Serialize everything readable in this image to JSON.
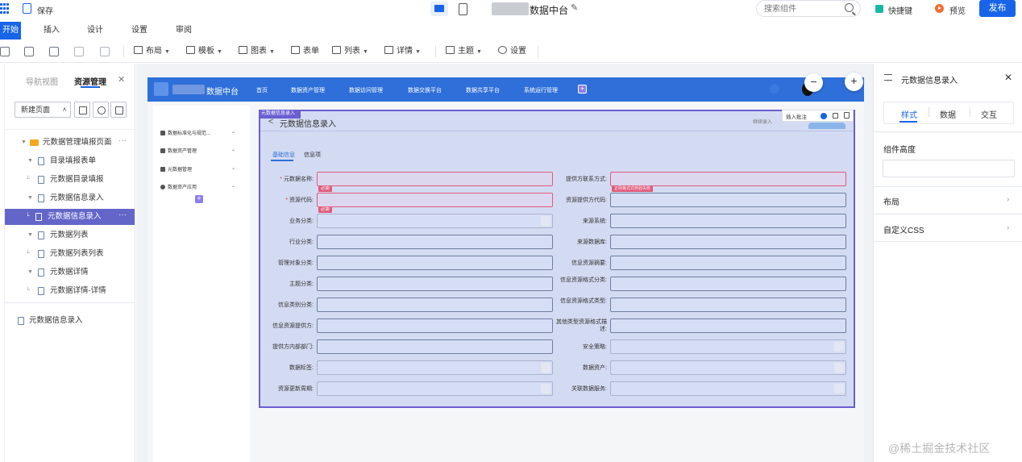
{
  "topbar": {
    "save_label": "保存",
    "page_title": "数据中台",
    "search_placeholder": "搜索组件",
    "shortcut_label": "快捷键",
    "preview_label": "预览",
    "publish_label": "发布"
  },
  "menu": {
    "tabs": [
      "开始",
      "插入",
      "设计",
      "设置",
      "审阅"
    ]
  },
  "toolbar": {
    "items": [
      {
        "label": "布局",
        "dropdown": true
      },
      {
        "label": "模板",
        "dropdown": true
      },
      {
        "label": "图表",
        "dropdown": true
      },
      {
        "label": "表单",
        "dropdown": false
      },
      {
        "label": "列表",
        "dropdown": true
      },
      {
        "label": "详情",
        "dropdown": true
      },
      {
        "label": "主题",
        "dropdown": true
      },
      {
        "label": "设置",
        "dropdown": false
      }
    ]
  },
  "left_panel": {
    "tab_nav": "导航视图",
    "tab_resource": "资源管理",
    "new_page_label": "新建页面",
    "tree": [
      {
        "label": "元数据管理填报页面",
        "type": "folder",
        "more": "···"
      },
      {
        "label": "目录填报表单",
        "type": "doc"
      },
      {
        "label": "元数据目录填报",
        "type": "doc"
      },
      {
        "label": "元数据信息录入",
        "type": "doc"
      },
      {
        "label": "元数据信息录入",
        "type": "doc",
        "selected": true,
        "more": "···"
      },
      {
        "label": "元数据列表",
        "type": "doc"
      },
      {
        "label": "元数据列表列表",
        "type": "doc"
      },
      {
        "label": "元数据详情",
        "type": "doc"
      },
      {
        "label": "元数据详情-详情",
        "type": "doc"
      }
    ],
    "bottom_item": "元数据信息录入"
  },
  "app": {
    "name": "数据中台",
    "nav": [
      "首页",
      "数据资产管理",
      "数据访问管理",
      "数据交换平台",
      "数据共享平台",
      "系统运行管理"
    ],
    "nav_add": "+",
    "side_nav": [
      "数据标准化与规范...",
      "数据资产管理",
      "元数据管理",
      "数据资产应用"
    ],
    "side_add": "+"
  },
  "form": {
    "tag": "元数据信息录入",
    "back": "<",
    "title": "元数据信息录入",
    "insert_label": "插入批注",
    "insert_badge": "0",
    "continue_label": "继续录入",
    "tabs": [
      "基础信息",
      "信息项"
    ],
    "left_fields": [
      {
        "label": "元数据名称:",
        "required": true,
        "error": "必填!"
      },
      {
        "label": "资源代码:",
        "required": true,
        "error": "必填!"
      },
      {
        "label": "业务分类:",
        "select": true,
        "disabled": true
      },
      {
        "label": "行业分类:"
      },
      {
        "label": "管理对象分类:"
      },
      {
        "label": "主题分类:"
      },
      {
        "label": "信息类别分类:"
      },
      {
        "label": "信息资源提供方:"
      },
      {
        "label": "提供方内部部门:"
      },
      {
        "label": "数据标签:",
        "select": true,
        "disabled": true
      },
      {
        "label": "资源更新周期:",
        "select": true,
        "disabled": true
      }
    ],
    "right_fields": [
      {
        "label": "提供方联系方式:",
        "error": "正则格式式校验失败"
      },
      {
        "label": "资源提供方代码:"
      },
      {
        "label": "来源系统:"
      },
      {
        "label": "来源数据库:"
      },
      {
        "label": "信息资源摘要:"
      },
      {
        "label": "信息资源格式分类:"
      },
      {
        "label": "信息资源格式类型:"
      },
      {
        "label": "其他类型资源格式描述:"
      },
      {
        "label": "安全策略:",
        "select": true,
        "disabled": true
      },
      {
        "label": "数据资产:",
        "select": true,
        "disabled": true
      },
      {
        "label": "关联数据服务:",
        "select": true,
        "disabled": true
      }
    ]
  },
  "zoom": {
    "out": "−",
    "in": "+"
  },
  "right_panel": {
    "title": "元数据信息录入",
    "tabs": [
      "样式",
      "数据",
      "交互"
    ],
    "height_label": "组件高度",
    "height_value": "",
    "rows": [
      "布局",
      "自定义CSS"
    ]
  },
  "watermark": "@稀土掘金技术社区",
  "colors": {
    "accent": "#1764e8",
    "header": "#2f6fd9",
    "selection": "#6a5ed1",
    "error": "#e05a7a"
  }
}
